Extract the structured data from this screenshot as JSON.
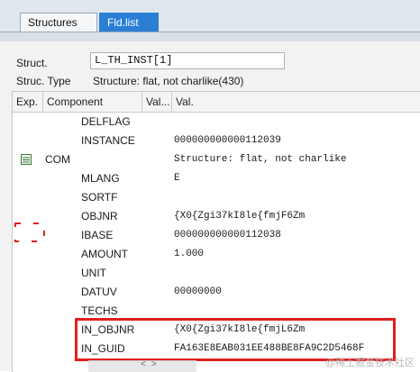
{
  "tabs": [
    "Structures",
    "Fld.list"
  ],
  "struct": {
    "label": "Struct.",
    "value": "L_TH_INST[1]"
  },
  "struct_type": {
    "label": "Struc. Type",
    "value": "Structure: flat, not charlike(430)"
  },
  "grid": {
    "headers": [
      "Exp.",
      "Component",
      "Val...",
      "Val."
    ],
    "rows": [
      {
        "exp": "",
        "name": "DELFLAG",
        "value": ""
      },
      {
        "exp": "",
        "name": "INSTANCE",
        "value": "000000000000112039"
      },
      {
        "exp": "COM",
        "name": "",
        "value": "Structure: flat, not charlike"
      },
      {
        "exp": "",
        "name": "MLANG",
        "value": "E"
      },
      {
        "exp": "",
        "name": "SORTF",
        "value": ""
      },
      {
        "exp": "",
        "name": "OBJNR",
        "value": "{X0{Zgi37kI8le{fmjF6Zm"
      },
      {
        "exp": "",
        "name": "IBASE",
        "value": "000000000000112038"
      },
      {
        "exp": "",
        "name": "AMOUNT",
        "value": "1.000"
      },
      {
        "exp": "",
        "name": "UNIT",
        "value": ""
      },
      {
        "exp": "",
        "name": "DATUV",
        "value": "00000000"
      },
      {
        "exp": "",
        "name": "TECHS",
        "value": ""
      },
      {
        "exp": "",
        "name": "IN_OBJNR",
        "value": "{X0{Zgi37kI8le{fmjL6Zm"
      },
      {
        "exp": "",
        "name": "IN_GUID",
        "value": "FA163E8EAB031EE488BE8FA9C2D5468F"
      }
    ]
  },
  "watermark": "@稀土掘金技术社区",
  "icons": {
    "structure": "structure-icon",
    "dashed": "dashed-selection-icon"
  },
  "colors": {
    "tab_active": "#2a7fd5",
    "highlight": "#e02020"
  }
}
